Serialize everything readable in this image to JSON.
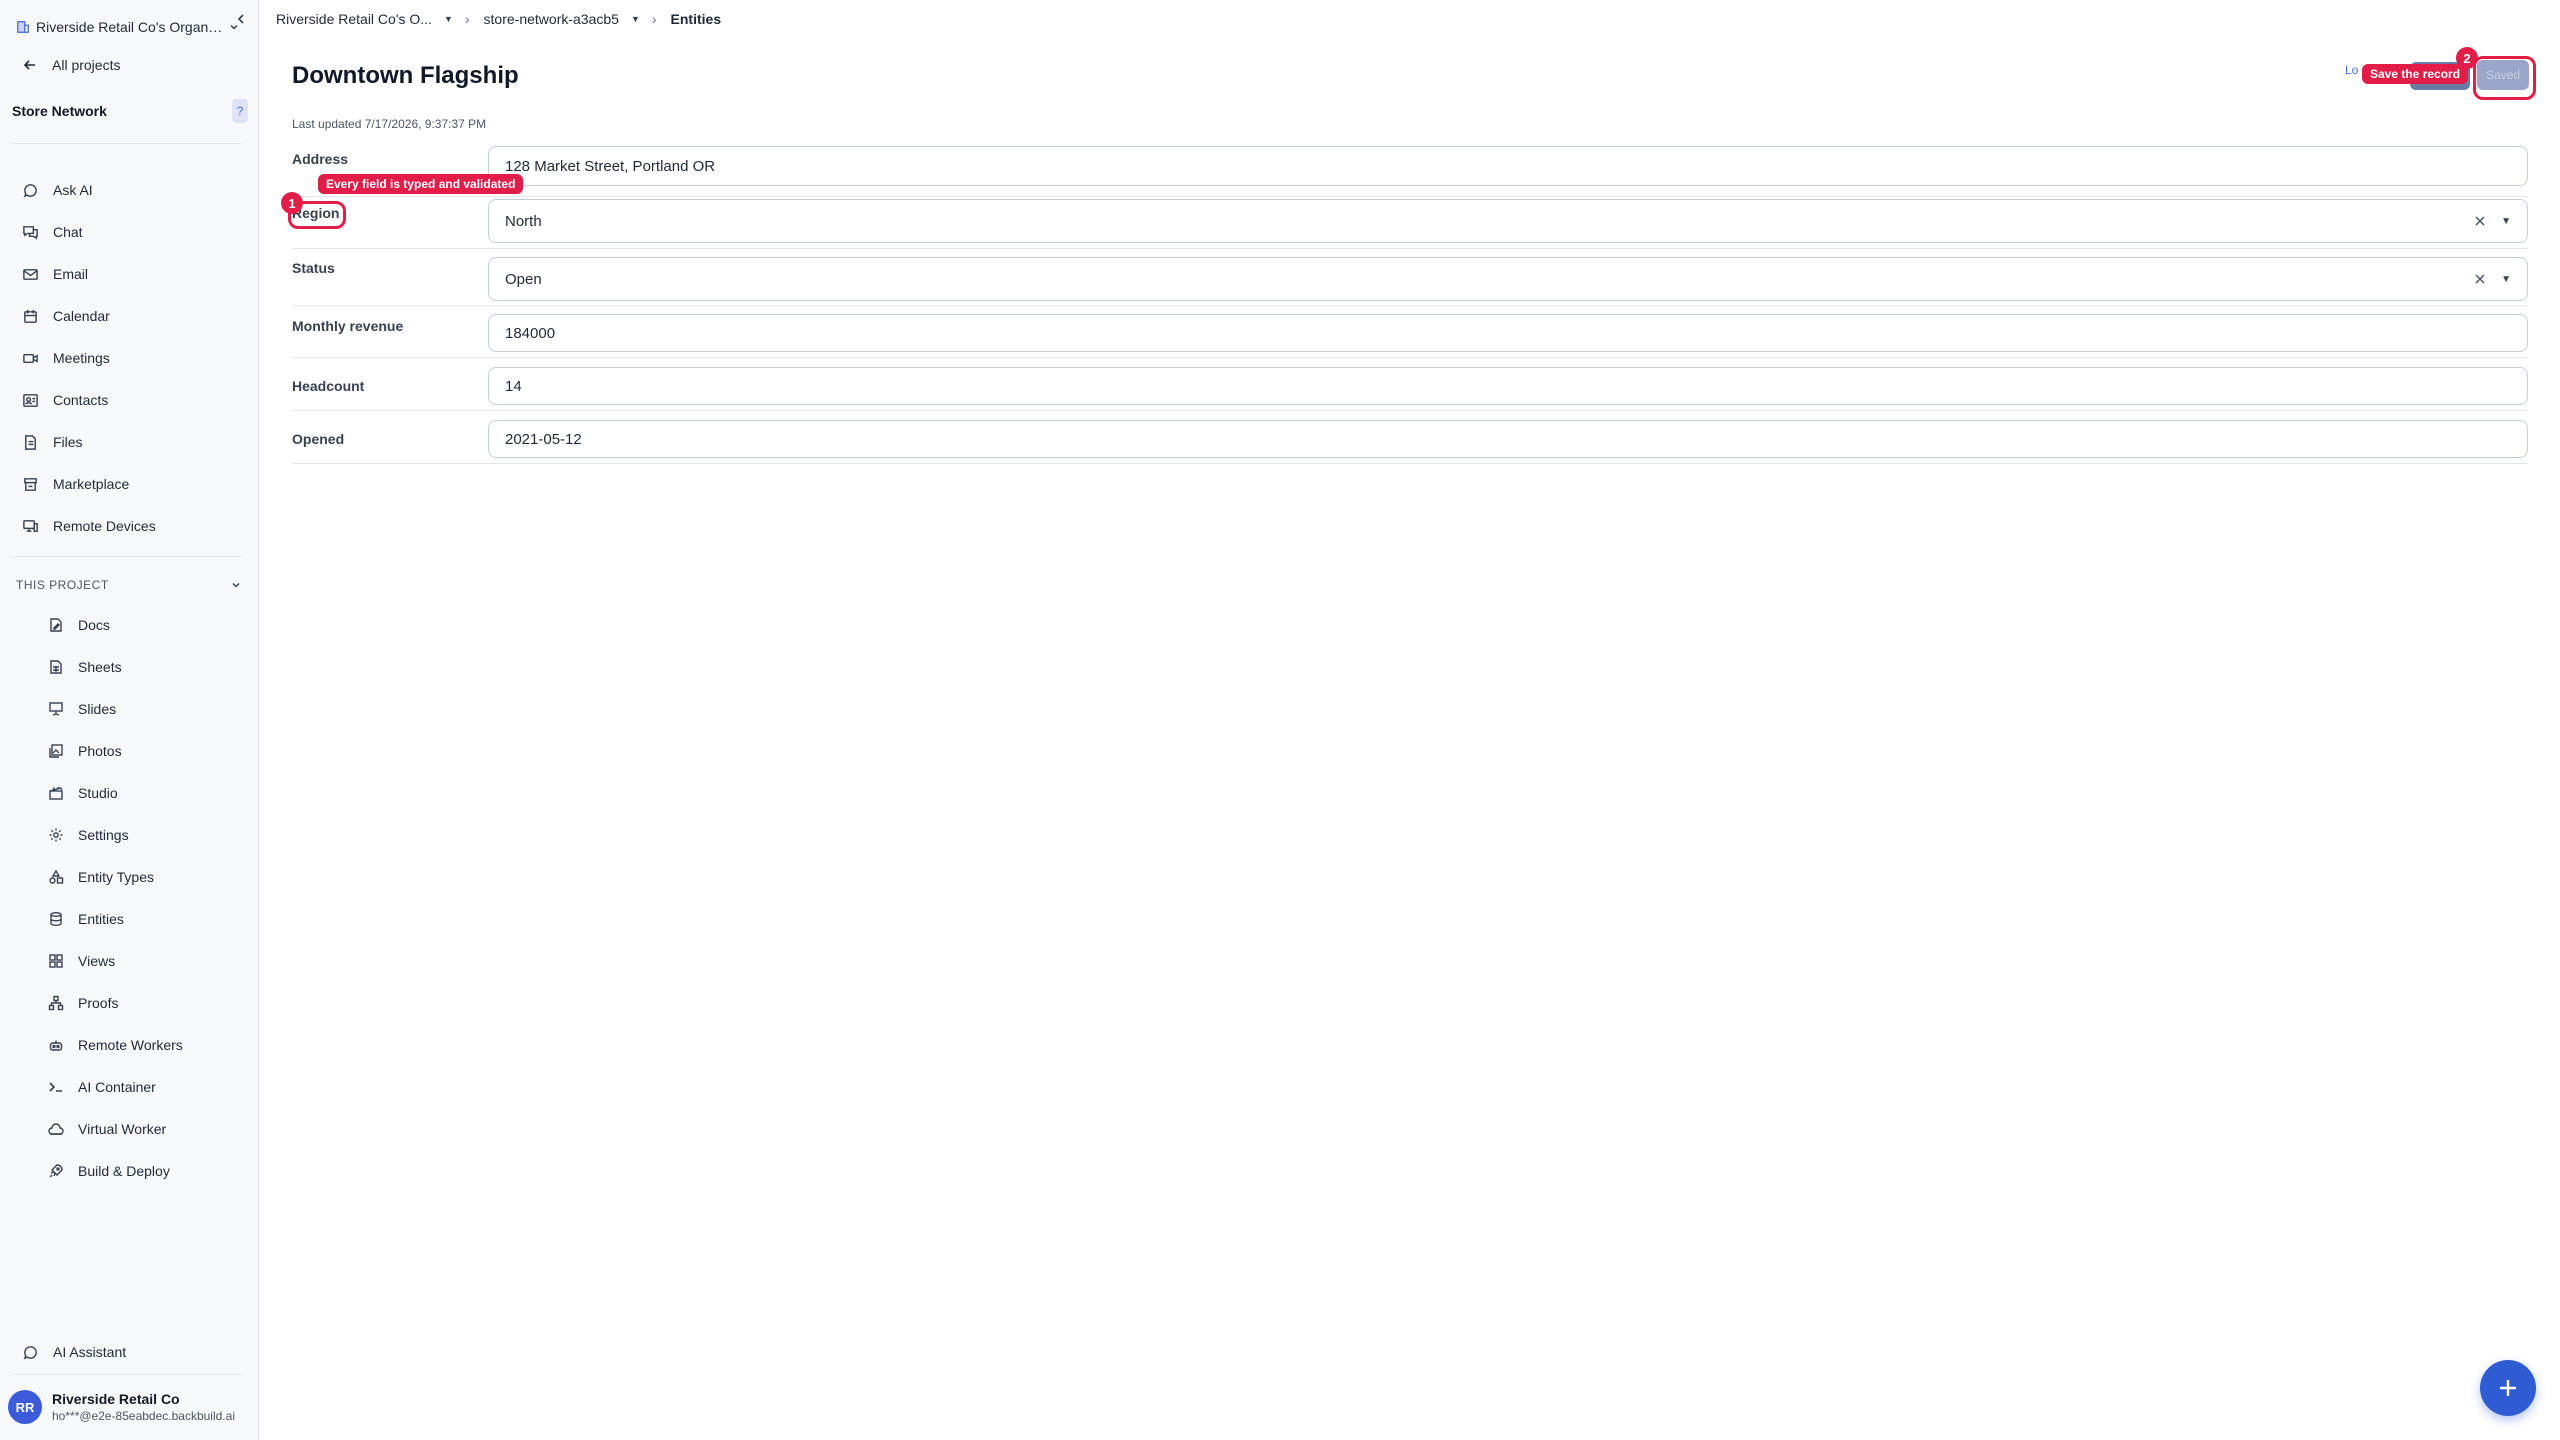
{
  "sidebar": {
    "org_name": "Riverside Retail Co's Organiz...",
    "back_label": "All projects",
    "project_name": "Store Network",
    "help_label": "?",
    "nav": [
      {
        "label": "Ask AI",
        "icon": "chat-bubble-icon"
      },
      {
        "label": "Chat",
        "icon": "chat-icon"
      },
      {
        "label": "Email",
        "icon": "mail-icon"
      },
      {
        "label": "Calendar",
        "icon": "calendar-icon"
      },
      {
        "label": "Meetings",
        "icon": "video-icon"
      },
      {
        "label": "Contacts",
        "icon": "contacts-icon"
      },
      {
        "label": "Files",
        "icon": "file-icon"
      },
      {
        "label": "Marketplace",
        "icon": "store-icon"
      },
      {
        "label": "Remote Devices",
        "icon": "monitor-icon"
      }
    ],
    "section_title": "THIS PROJECT",
    "project_items": [
      {
        "label": "Docs",
        "icon": "doc-edit-icon"
      },
      {
        "label": "Sheets",
        "icon": "sheet-icon"
      },
      {
        "label": "Slides",
        "icon": "presentation-icon"
      },
      {
        "label": "Photos",
        "icon": "photos-icon"
      },
      {
        "label": "Studio",
        "icon": "clapper-icon"
      },
      {
        "label": "Settings",
        "icon": "gear-icon"
      },
      {
        "label": "Entity Types",
        "icon": "shapes-icon"
      },
      {
        "label": "Entities",
        "icon": "database-icon"
      },
      {
        "label": "Views",
        "icon": "grid-icon"
      },
      {
        "label": "Proofs",
        "icon": "hierarchy-icon"
      },
      {
        "label": "Remote Workers",
        "icon": "robot-icon"
      },
      {
        "label": "AI Container",
        "icon": "terminal-icon"
      },
      {
        "label": "Virtual Worker",
        "icon": "cloud-worker-icon"
      },
      {
        "label": "Build & Deploy",
        "icon": "rocket-icon"
      }
    ],
    "assistant_label": "AI Assistant",
    "user": {
      "initials": "RR",
      "name": "Riverside Retail Co",
      "email": "ho***@e2e-85eabdec.backbuild.ai"
    }
  },
  "breadcrumb": {
    "org": "Riverside Retail Co's O...",
    "project": "store-network-a3acb5",
    "current": "Entities"
  },
  "record": {
    "title": "Downtown Flagship",
    "last_updated": "Last updated 7/17/2026, 9:37:37 PM",
    "fields": [
      {
        "label": "Address",
        "value": "128 Market Street, Portland OR"
      },
      {
        "label": "Region",
        "value": "North"
      },
      {
        "label": "Status",
        "value": "Open"
      },
      {
        "label": "Monthly revenue",
        "value": "184000"
      },
      {
        "label": "Headcount",
        "value": "14"
      },
      {
        "label": "Opened",
        "value": "2021-05-12"
      }
    ]
  },
  "header_actions": {
    "lo_text": "Lo",
    "save_label": "Saved"
  },
  "annotations": {
    "marker_1": "1",
    "tip_1": "Every field is typed and validated",
    "marker_2": "2",
    "tip_2": "Save the record"
  },
  "fab_label": "+",
  "colors": {
    "accent": "#2f5bd3",
    "annotation": "#e11d48",
    "sidebar_bg": "#f7f8fa"
  }
}
